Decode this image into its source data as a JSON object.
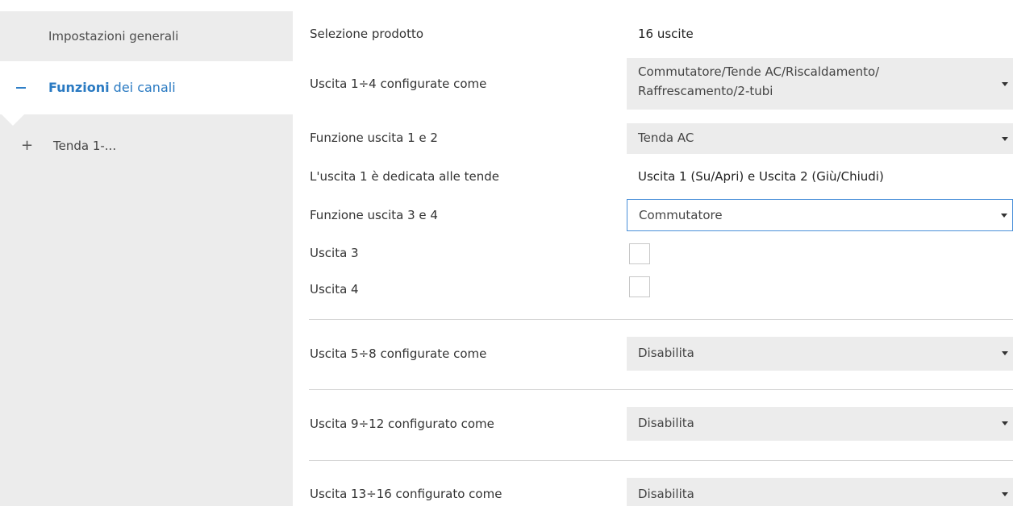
{
  "sidebar": {
    "general_label": "Impostazioni generali",
    "channels_label_bold": "Funzioni",
    "channels_label_rest": " dei canali",
    "tenda_label": "Tenda 1-..."
  },
  "main": {
    "product": {
      "label": "Selezione prodotto",
      "value": "16 uscite"
    },
    "out1_4": {
      "label": "Uscita 1÷4 configurate come",
      "line1": "Commutatore/Tende AC/Riscaldamento/",
      "line2": "Raffrescamento/2-tubi"
    },
    "func12": {
      "label": "Funzione uscita 1 e 2",
      "value": "Tenda AC"
    },
    "dedicated": {
      "label": "L'uscita 1 è dedicata alle tende",
      "value": "Uscita 1 (Su/Apri) e Uscita 2 (Giù/Chiudi)"
    },
    "func34": {
      "label": "Funzione uscita 3 e 4",
      "value": "Commutatore"
    },
    "out3": {
      "label": "Uscita 3",
      "checked": false
    },
    "out4": {
      "label": "Uscita 4",
      "checked": false
    },
    "out5_8": {
      "label": "Uscita 5÷8 configurate come",
      "value": "Disabilita"
    },
    "out9_12": {
      "label": "Uscita 9÷12 configurato come",
      "value": "Disabilita"
    },
    "out13_16": {
      "label": "Uscita 13÷16 configurato come",
      "value": "Disabilita"
    }
  },
  "colors": {
    "accent": "#2a7ac2",
    "sidebar_bg": "#ececec",
    "focus_border": "#4a90d9"
  }
}
